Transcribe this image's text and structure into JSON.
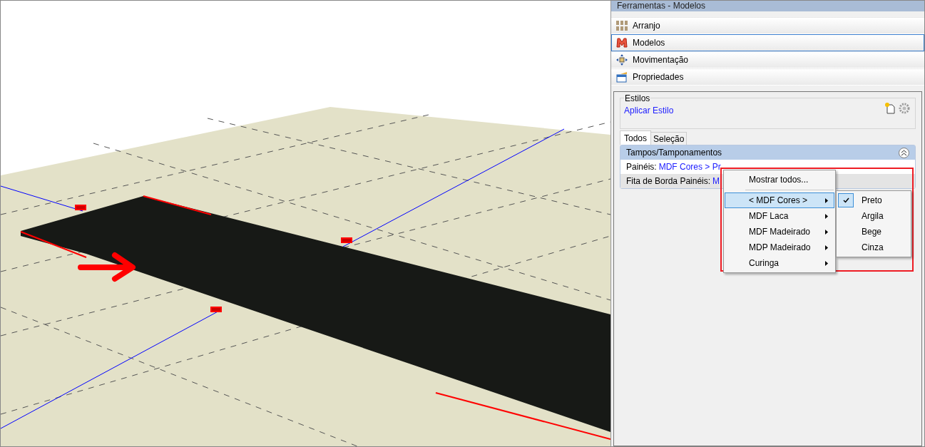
{
  "panel": {
    "title": "Ferramentas - Modelos"
  },
  "modules": [
    {
      "label": "Arranjo",
      "selected": false
    },
    {
      "label": "Modelos",
      "selected": true
    },
    {
      "label": "Movimentação",
      "selected": false
    },
    {
      "label": "Propriedades",
      "selected": false
    }
  ],
  "styles": {
    "legend": "Estilos",
    "link": "Aplicar Estilo"
  },
  "tabs": [
    {
      "label": "Todos",
      "selected": true
    },
    {
      "label": "Seleção",
      "selected": false
    }
  ],
  "section": {
    "title": "Tampos/Tamponamentos",
    "expanded": true,
    "rows": [
      {
        "label": "Painéis:",
        "value": "MDF Cores > Pr"
      },
      {
        "label": "Fita de Borda Painéis:",
        "value": "M"
      }
    ]
  },
  "context_menu": {
    "items": [
      {
        "kind": "command",
        "label": "Mostrar todos...",
        "selected": false
      },
      {
        "kind": "submenu",
        "label": "< MDF Cores >",
        "selected": true
      },
      {
        "kind": "submenu",
        "label": "MDF Laca",
        "selected": false
      },
      {
        "kind": "submenu",
        "label": "MDF Madeirado",
        "selected": false
      },
      {
        "kind": "submenu",
        "label": "MDP Madeirado",
        "selected": false
      },
      {
        "kind": "submenu",
        "label": "Curinga",
        "selected": false
      }
    ],
    "submenu": [
      {
        "label": "Preto",
        "checked": true
      },
      {
        "label": "Argila",
        "checked": false
      },
      {
        "label": "Bege",
        "checked": false
      },
      {
        "label": "Cinza",
        "checked": false
      }
    ]
  }
}
